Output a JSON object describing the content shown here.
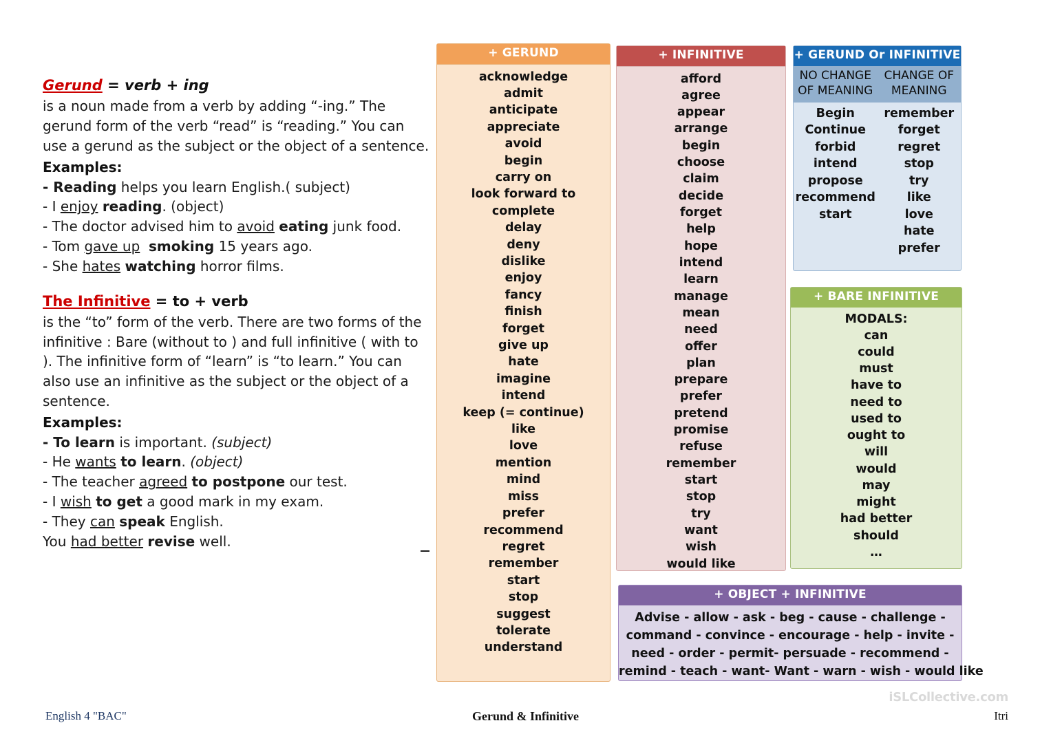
{
  "left_column": {
    "gerund": {
      "heading_term": "Gerund",
      "heading_rest": " = verb + ing",
      "paragraph": " is a noun made from a verb by adding “-ing.” The gerund form of the verb “read” is “reading.” You can use a gerund as the subject or the object of a sentence.",
      "examples_label": "Examples:",
      "examples": [
        "- Reading helps you learn English.( subject)",
        "- I enjoy reading. (object)",
        "- The doctor advised him to avoid eating junk food.",
        "- Tom gave up  smoking 15 years ago.",
        "- She hates watching horror films."
      ]
    },
    "infinitive": {
      "heading_term": "The Infinitive",
      "heading_rest": " =  to + verb",
      "paragraph": "is the “to” form of the verb. There are two forms of the infinitive : Bare (without to ) and full infinitive ( with to ). The infinitive form of “learn” is “to learn.” You can also use an infinitive as the subject or the object of a sentence.",
      "examples_label": "Examples:",
      "examples": [
        "- To learn is important. (subject)",
        "- He wants to learn. (object)",
        "- The teacher agreed to postpone our test.",
        "- I wish to get a good mark in my exam.",
        "- They can speak English.",
        "You had better revise well."
      ]
    }
  },
  "cards": {
    "gerund": {
      "title": "+ GERUND",
      "header_color": "#F2A158",
      "body_color": "#FBE5CE",
      "words": [
        "acknowledge",
        "admit",
        "anticipate",
        "appreciate",
        "avoid",
        "begin",
        "carry on",
        "look forward to",
        "complete",
        "delay",
        "deny",
        "dislike",
        "enjoy",
        "fancy",
        "finish",
        "forget",
        "give up",
        "hate",
        "imagine",
        "intend",
        "keep (= continue)",
        "like",
        "love",
        "mention",
        "mind",
        "miss",
        "prefer",
        "recommend",
        "regret",
        "remember",
        "start",
        "stop",
        "suggest",
        "tolerate",
        "understand"
      ]
    },
    "infinitive": {
      "title": "+ INFINITIVE",
      "header_color": "#C0504D",
      "body_color": "#EEDADA",
      "words": [
        "afford",
        "agree",
        "appear",
        "arrange",
        "begin",
        "choose",
        "claim",
        "decide",
        "forget",
        "help",
        "hope",
        "intend",
        "learn",
        "manage",
        "mean",
        "need",
        "offer",
        "plan",
        "prepare",
        "prefer",
        "pretend",
        "promise",
        "refuse",
        "remember",
        "start",
        "stop",
        "try",
        "want",
        "wish",
        "would like"
      ]
    },
    "gerund_or_infinitive": {
      "title": "+ GERUND Or INFINITIVE",
      "header_color": "#1B6CB5",
      "subheader_color": "#92B0CE",
      "body_color": "#DCE6F1",
      "subheader_left": "NO CHANGE OF MEANING",
      "subheader_right": "CHANGE OF MEANING",
      "left_words": [
        "Begin",
        "Continue",
        "forbid",
        "intend",
        "propose",
        "recommend",
        "start"
      ],
      "right_words": [
        "remember",
        "forget",
        "regret",
        "stop",
        "try",
        "like",
        "love",
        "hate",
        "prefer"
      ]
    },
    "bare_infinitive": {
      "title": "+ BARE INFINITIVE",
      "header_color": "#9BBB59",
      "body_color": "#E4EDD4",
      "subtitle": "MODALS:",
      "words": [
        "can",
        "could",
        "must",
        "have to",
        "need to",
        "used to",
        "ought to",
        "will",
        "would",
        "may",
        "might",
        "had better",
        "should",
        "…"
      ]
    },
    "object_infinitive": {
      "title": "+ OBJECT + INFINITIVE",
      "header_color": "#8064A2",
      "body_color": "#DDD6E8",
      "lines": [
        "Advise -  allow -  ask  -  beg  -  cause  -  challenge -",
        "command  -  convince  -  encourage  -  help -   invite -",
        "need  -  order  -  permit-  persuade -  recommend -",
        "remind -  teach -  want-  Want -  warn -  wish -  would like"
      ]
    }
  },
  "footer": {
    "left": "English 4 \"BAC\"",
    "center": "Gerund & Infinitive",
    "right": "Itri",
    "watermark": "iSLCollective.com"
  }
}
